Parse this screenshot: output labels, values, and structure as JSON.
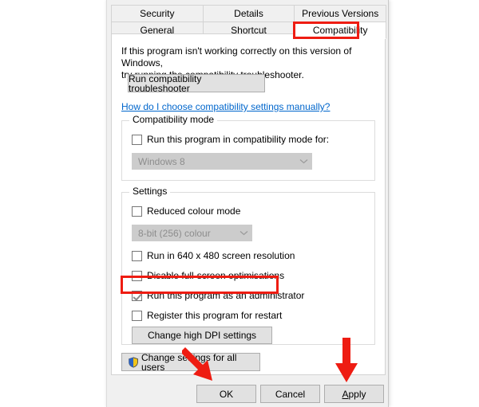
{
  "dialog": {
    "tabs_row1": [
      {
        "label": "Security",
        "active": false
      },
      {
        "label": "Details",
        "active": false
      },
      {
        "label": "Previous Versions",
        "active": false
      }
    ],
    "tabs_row2": [
      {
        "label": "General",
        "active": false
      },
      {
        "label": "Shortcut",
        "active": false
      },
      {
        "label": "Compatibility",
        "active": true
      }
    ],
    "intro_line1": "If this program isn't working correctly on this version of Windows,",
    "intro_line2": "try running the compatibility troubleshooter.",
    "run_troubleshooter_label": "Run compatibility troubleshooter",
    "help_link_label": "How do I choose compatibility settings manually?",
    "compatibility_mode": {
      "legend": "Compatibility mode",
      "checkbox_label": "Run this program in compatibility mode for:",
      "checkbox_checked": false,
      "dropdown_value": "Windows 8",
      "dropdown_disabled": true
    },
    "settings": {
      "legend": "Settings",
      "reduced_colour_label": "Reduced colour mode",
      "reduced_colour_checked": false,
      "colour_depth_value": "8-bit (256) colour",
      "colour_depth_disabled": true,
      "checkboxes": [
        {
          "label": "Run in 640 x 480 screen resolution",
          "checked": false
        },
        {
          "label": "Disable full-screen optimisations",
          "checked": false
        },
        {
          "label": "Run this program as an administrator",
          "checked": true
        },
        {
          "label": "Register this program for restart",
          "checked": false
        }
      ],
      "change_dpi_label": "Change high DPI settings"
    },
    "change_all_users_label": "Change settings for all users",
    "footer": {
      "ok_label": "OK",
      "cancel_label": "Cancel",
      "apply_label_accel": "A",
      "apply_label_rest": "pply"
    }
  },
  "annotations": {
    "highlight_color": "#ee1c12",
    "boxes": [
      {
        "target": "Compatibility tab"
      },
      {
        "target": "Run this program as an administrator"
      }
    ],
    "arrows": [
      {
        "target": "OK",
        "direction": "down-right"
      },
      {
        "target": "Apply",
        "direction": "down"
      }
    ]
  }
}
